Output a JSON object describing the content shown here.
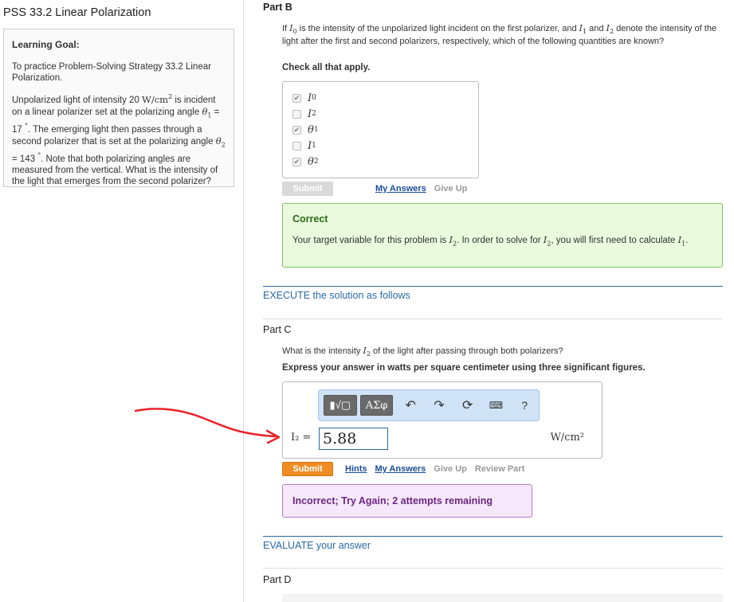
{
  "left": {
    "title": "PSS 33.2 Linear Polarization",
    "goal_label": "Learning Goal:",
    "goal_text": "To practice Problem-Solving Strategy 33.2 Linear Polarization.",
    "problem": {
      "t1": "Unpolarized light of intensity 20 ",
      "unit_w": "W/cm",
      "t2": " is incident on a linear polarizer set at the polarizing angle ",
      "theta1": "θ",
      "t3": " = 17 ",
      "deg": "°",
      "t4": ". The emerging light then passes through a second polarizer that is set at the polarizing angle ",
      "t5": " = 143 ",
      "t6": ". Note that both polarizing angles are measured from the vertical. What is the intensity of the light that emerges from the second polarizer?"
    }
  },
  "partB": {
    "label": "Part B",
    "q1": "If ",
    "q2": " is the intensity of the unpolarized light incident on the first polarizer, and ",
    "q3": " and ",
    "q4": " denote the intensity of the light after the first and second polarizers, respectively, which of the following quantities are known?",
    "instruction": "Check all that apply.",
    "options": [
      {
        "sym": "I",
        "sub": "0",
        "checked": true
      },
      {
        "sym": "I",
        "sub": "2",
        "checked": false
      },
      {
        "sym": "θ",
        "sub": "1",
        "checked": true
      },
      {
        "sym": "I",
        "sub": "1",
        "checked": false
      },
      {
        "sym": "θ",
        "sub": "2",
        "checked": true
      }
    ],
    "submit": "Submit",
    "my_answers": "My Answers",
    "give_up": "Give Up",
    "feedback_title": "Correct",
    "feedback_t1": "Your target variable for this problem is ",
    "feedback_t2": ". In order to solve for ",
    "feedback_t3": ", you will first need to calculate ",
    "feedback_t4": "."
  },
  "execute": {
    "prefix": "EXECUTE",
    "rest": " the solution as follows"
  },
  "partC": {
    "label": "Part C",
    "q1": "What is the intensity ",
    "q2": " of the light after passing through both polarizers?",
    "instruction": "Express your answer in watts per square centimeter using three significant figures.",
    "toolbar": {
      "templates": "▮√▢",
      "greek": "AΣφ",
      "help": "?"
    },
    "answer_label": "I₂ =",
    "answer_value": "5.88",
    "units": "W/cm²",
    "submit": "Submit",
    "hints": "Hints",
    "my_answers": "My Answers",
    "give_up": "Give Up",
    "review": "Review Part",
    "feedback": "Incorrect; Try Again; 2 attempts remaining"
  },
  "evaluate": {
    "prefix": "EVALUATE",
    "rest": " your answer"
  },
  "partD": {
    "label": "Part D"
  },
  "colors": {
    "accent": "#2b6aa6",
    "submit": "#f08c24",
    "correct_bg": "#e9fadd",
    "incorrect_bg": "#f6e8fa",
    "arrow": "#e8232a"
  }
}
